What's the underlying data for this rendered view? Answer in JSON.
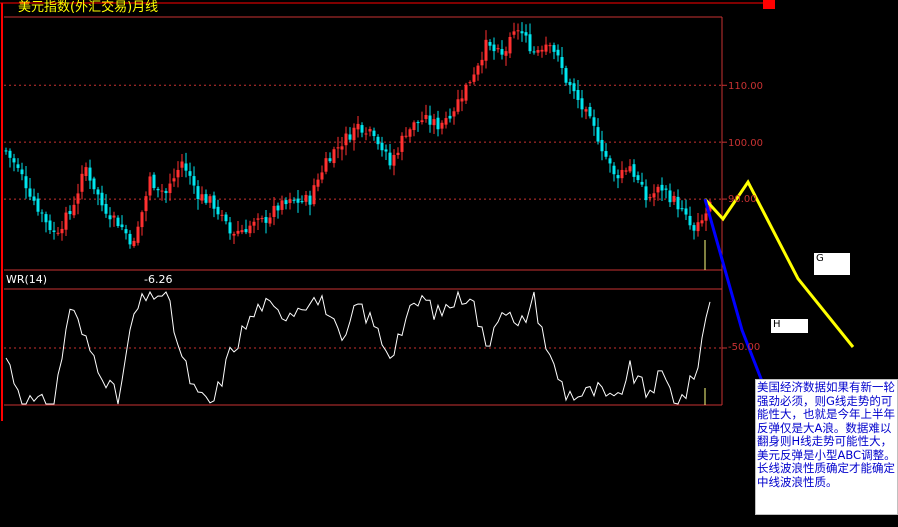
{
  "title": "美元指数(外汇交易)月线",
  "indicator": {
    "name": "WR(14)",
    "value": "-6.26"
  },
  "price_ticks": [
    "110.00",
    "100.00",
    "90.00"
  ],
  "wr_ticks": [
    "-50.00"
  ],
  "wave_labels": {
    "g": "G",
    "h": "H"
  },
  "note": "美国经济数据如果有新一轮强劲必须，则G线走势的可能性大，也就是今年上半年反弹仅是大A浪。数据难以翻身则H线走势可能性大，美元反弹是小型ABC调整。长线波浪性质确定才能确定中线波浪性质。",
  "colors": {
    "up": "#ff3030",
    "down": "#00e5ee",
    "grid": "#c83232",
    "wr_line": "#ffffff",
    "g_line": "#ffff00",
    "h_line": "#0000ff",
    "title": "#ffff00"
  },
  "chart_data": [
    {
      "type": "candlestick",
      "title": "美元指数(外汇交易)月线",
      "period": "monthly",
      "y_ticks": [
        110,
        100,
        90
      ],
      "ylim": [
        77.5,
        122
      ],
      "close_anchors": [
        [
          0,
          98.5
        ],
        [
          4,
          94
        ],
        [
          8,
          88.5
        ],
        [
          12,
          84
        ],
        [
          16,
          87.5
        ],
        [
          20,
          95.5
        ],
        [
          24,
          89
        ],
        [
          28,
          86
        ],
        [
          32,
          82
        ],
        [
          36,
          93.5
        ],
        [
          40,
          91
        ],
        [
          44,
          96.5
        ],
        [
          48,
          91
        ],
        [
          52,
          89
        ],
        [
          56,
          84
        ],
        [
          60,
          85
        ],
        [
          64,
          86
        ],
        [
          68,
          88.5
        ],
        [
          72,
          89.5
        ],
        [
          76,
          90
        ],
        [
          80,
          97
        ],
        [
          84,
          100
        ],
        [
          88,
          103
        ],
        [
          92,
          102
        ],
        [
          96,
          96
        ],
        [
          100,
          102
        ],
        [
          104,
          104
        ],
        [
          108,
          103
        ],
        [
          112,
          106
        ],
        [
          116,
          111
        ],
        [
          120,
          117
        ],
        [
          124,
          115
        ],
        [
          128,
          120
        ],
        [
          132,
          116
        ],
        [
          136,
          118
        ],
        [
          140,
          111
        ],
        [
          144,
          106
        ],
        [
          148,
          101
        ],
        [
          152,
          94
        ],
        [
          156,
          96
        ],
        [
          160,
          90
        ],
        [
          164,
          92
        ],
        [
          168,
          89
        ],
        [
          172,
          84
        ],
        [
          174,
          86
        ],
        [
          176,
          89
        ]
      ],
      "last_close": 90,
      "projection_g": [
        [
          0,
          90
        ],
        [
          1,
          86.5
        ],
        [
          2,
          93
        ],
        [
          3,
          76
        ],
        [
          4,
          64
        ]
      ],
      "projection_h": [
        [
          0,
          90
        ],
        [
          1,
          67
        ],
        [
          2,
          44
        ]
      ]
    },
    {
      "type": "line",
      "name": "WR(14)",
      "last": -6.26,
      "ylim": [
        -100,
        0
      ],
      "y_ticks": [
        -50
      ],
      "anchors": [
        [
          0,
          -58
        ],
        [
          4,
          -95
        ],
        [
          8,
          -100
        ],
        [
          12,
          -100
        ],
        [
          16,
          -12
        ],
        [
          20,
          -45
        ],
        [
          24,
          -70
        ],
        [
          28,
          -98
        ],
        [
          32,
          -20
        ],
        [
          36,
          0
        ],
        [
          40,
          -2
        ],
        [
          44,
          -60
        ],
        [
          48,
          -95
        ],
        [
          52,
          -98
        ],
        [
          56,
          -55
        ],
        [
          60,
          -30
        ],
        [
          64,
          -10
        ],
        [
          68,
          -20
        ],
        [
          72,
          -15
        ],
        [
          76,
          -5
        ],
        [
          80,
          -12
        ],
        [
          84,
          -50
        ],
        [
          88,
          -10
        ],
        [
          92,
          -30
        ],
        [
          96,
          -55
        ],
        [
          100,
          -25
        ],
        [
          104,
          -5
        ],
        [
          108,
          -20
        ],
        [
          112,
          -8
        ],
        [
          116,
          0
        ],
        [
          120,
          -50
        ],
        [
          124,
          -10
        ],
        [
          128,
          -35
        ],
        [
          132,
          -5
        ],
        [
          136,
          -60
        ],
        [
          140,
          -90
        ],
        [
          144,
          -92
        ],
        [
          148,
          -88
        ],
        [
          152,
          -100
        ],
        [
          156,
          -70
        ],
        [
          160,
          -90
        ],
        [
          164,
          -75
        ],
        [
          168,
          -100
        ],
        [
          172,
          -78
        ],
        [
          176,
          -6
        ]
      ]
    }
  ]
}
